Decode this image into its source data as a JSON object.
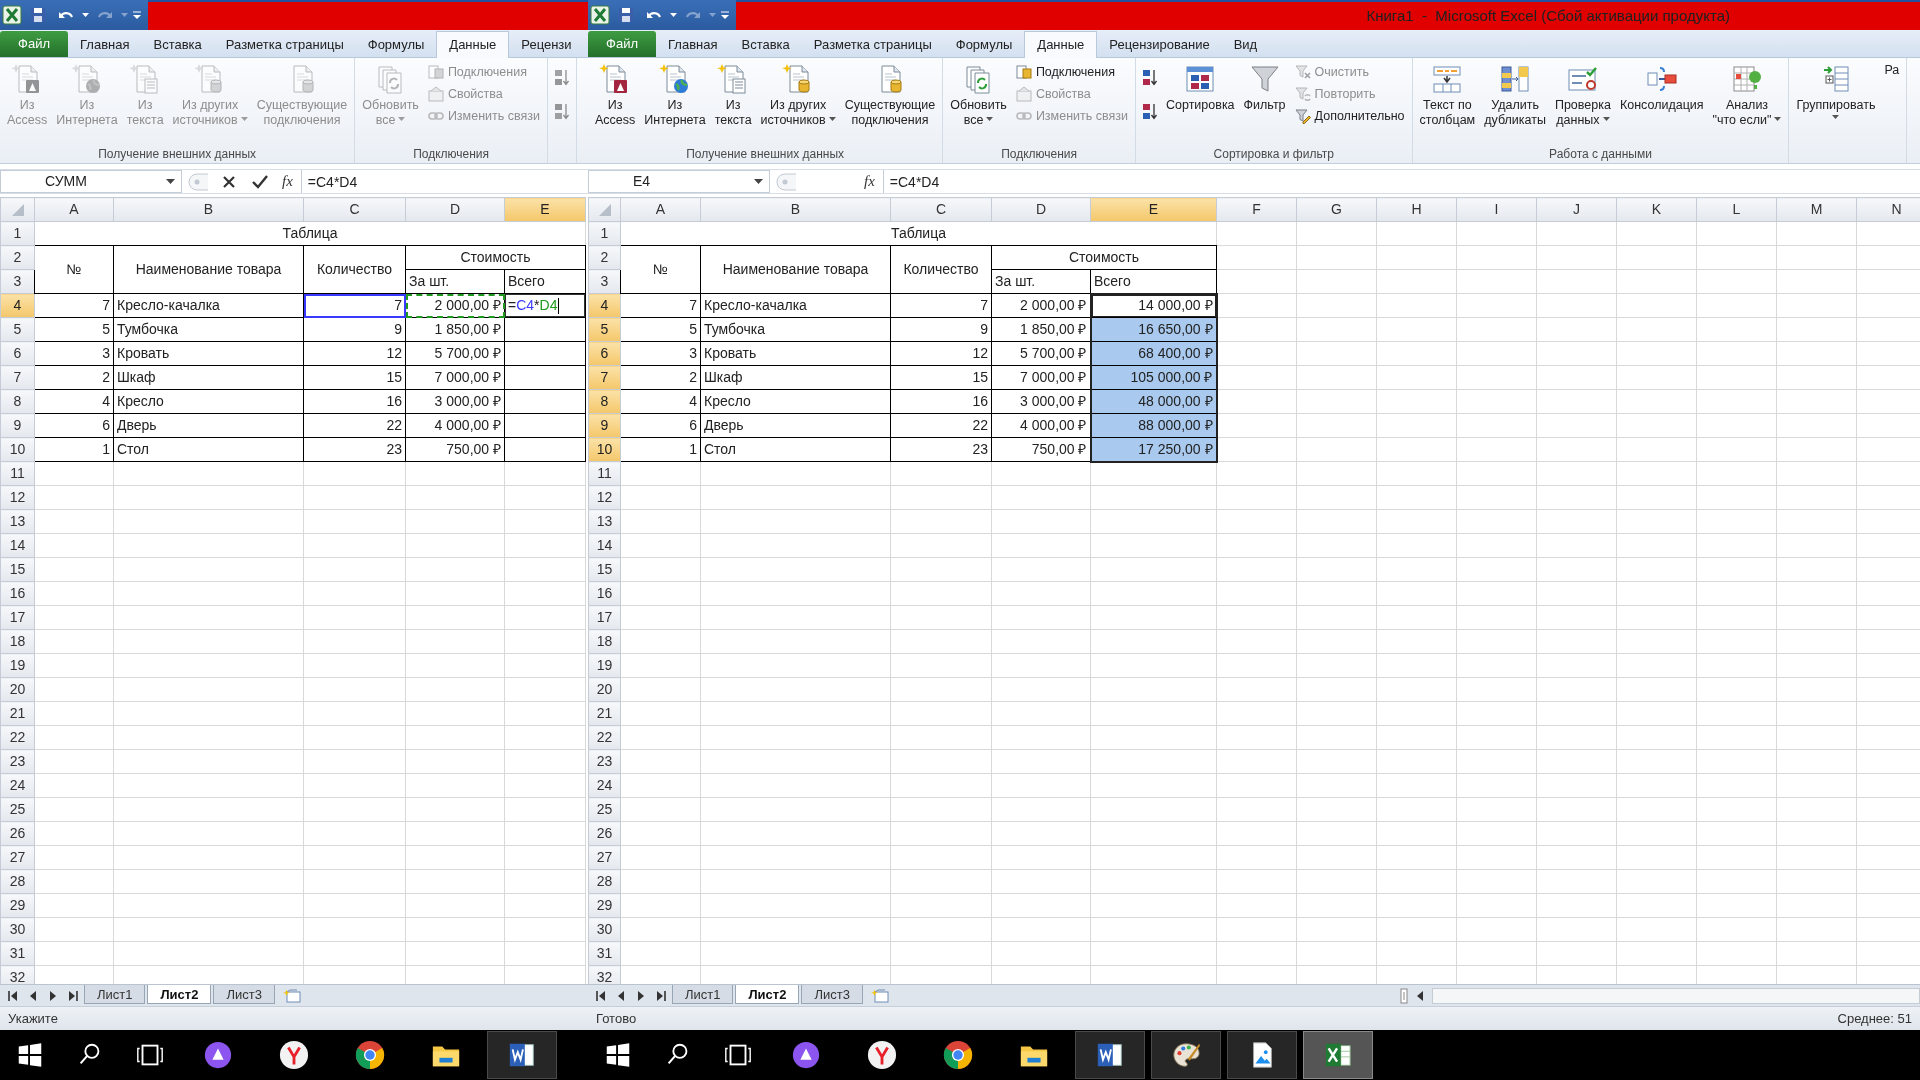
{
  "windows": [
    {
      "quick_access": [
        {
          "kind": "save",
          "disabled": false
        },
        {
          "kind": "undo",
          "disabled": false
        },
        {
          "kind": "redo",
          "disabled": true
        }
      ],
      "ribbon_tabs": [
        {
          "kind": "file",
          "label": "Файл",
          "selected": false
        },
        {
          "kind": "tab",
          "label": "Главная",
          "selected": false
        },
        {
          "kind": "tab",
          "label": "Вставка",
          "selected": false
        },
        {
          "kind": "tab",
          "label": "Разметка страницы",
          "selected": false
        },
        {
          "kind": "tab",
          "label": "Формулы",
          "selected": false
        },
        {
          "kind": "tab",
          "label": "Данные",
          "selected": true
        },
        {
          "kind": "tab",
          "label": "Рецензи",
          "selected": false
        }
      ],
      "ribbon_groups": [
        {
          "label": "Получение внешних данных",
          "items": [
            {
              "kind": "large",
              "label": "Из\nAccess",
              "disabled": true,
              "dropdown": false
            },
            {
              "kind": "large",
              "label": "Из\nИнтернета",
              "disabled": true,
              "dropdown": false
            },
            {
              "kind": "large",
              "label": "Из\nтекста",
              "disabled": true,
              "dropdown": false
            },
            {
              "kind": "large",
              "label": "Из других\nисточников",
              "disabled": true,
              "dropdown": true
            },
            {
              "kind": "large",
              "label": "Существующие\nподключения",
              "disabled": true,
              "dropdown": false
            }
          ]
        },
        {
          "label": "Подключения",
          "items": [
            {
              "kind": "large",
              "label": "Обновить\nвсе",
              "disabled": true,
              "dropdown": true
            },
            {
              "kind": "small",
              "label": "Подключения",
              "disabled": true,
              "dropdown": false
            },
            {
              "kind": "small",
              "label": "Свойства",
              "disabled": true,
              "dropdown": false
            },
            {
              "kind": "small",
              "label": "Изменить связи",
              "disabled": true,
              "dropdown": false
            }
          ]
        },
        {
          "items": [
            {
              "kind": "icon",
              "disabled": true,
              "dropdown": false
            },
            {
              "kind": "icon",
              "disabled": true,
              "dropdown": false
            }
          ]
        }
      ],
      "formula_bar": {
        "name_box": "СУММ",
        "editing": true,
        "function_label": "fx",
        "formula": "=C4*D4"
      },
      "sheet": {
        "columns": [
          {
            "label": "A",
            "selected": false
          },
          {
            "label": "B",
            "selected": false
          },
          {
            "label": "C",
            "selected": false
          },
          {
            "label": "D",
            "selected": false
          },
          {
            "label": "E",
            "selected": true
          }
        ],
        "row_headers": [
          {
            "label": "1",
            "selected": false
          },
          {
            "label": "2",
            "selected": false
          },
          {
            "label": "3",
            "selected": false
          },
          {
            "label": "4",
            "selected": true
          },
          {
            "label": "5",
            "selected": false
          },
          {
            "label": "6",
            "selected": false
          },
          {
            "label": "7",
            "selected": false
          },
          {
            "label": "8",
            "selected": false
          },
          {
            "label": "9",
            "selected": false
          },
          {
            "label": "10",
            "selected": false
          },
          {
            "label": "11",
            "selected": false
          },
          {
            "label": "12",
            "selected": false
          },
          {
            "label": "13",
            "selected": false
          },
          {
            "label": "14",
            "selected": false
          },
          {
            "label": "15",
            "selected": false
          },
          {
            "label": "16",
            "selected": false
          },
          {
            "label": "17",
            "selected": false
          },
          {
            "label": "18",
            "selected": false
          },
          {
            "label": "19",
            "selected": false
          },
          {
            "label": "20",
            "selected": false
          },
          {
            "label": "21",
            "selected": false
          },
          {
            "label": "22",
            "selected": false
          },
          {
            "label": "23",
            "selected": false
          },
          {
            "label": "24",
            "selected": false
          },
          {
            "label": "25",
            "selected": false
          },
          {
            "label": "26",
            "selected": false
          },
          {
            "label": "27",
            "selected": false
          },
          {
            "label": "28",
            "selected": false
          },
          {
            "label": "29",
            "selected": false
          },
          {
            "label": "30",
            "selected": false
          },
          {
            "label": "31",
            "selected": false
          },
          {
            "label": "32",
            "selected": false
          }
        ],
        "table": {
          "title": "Таблица",
          "headers": {
            "no": "№",
            "name": "Наименование товара",
            "qty": "Количество",
            "cost": "Стоимость",
            "unit": "За шт.",
            "total": "Всего"
          },
          "rows": [
            {
              "no": "7",
              "name": "Кресло-качалка",
              "qty": "7",
              "unit": "2 000,00 ₽",
              "total_selected": false,
              "total_active": false,
              "formula_parts": [
                {
                  "text": "="
                },
                {
                  "text": "C4",
                  "color": "#3a3aff"
                },
                {
                  "text": "*"
                },
                {
                  "text": "D4",
                  "color": "#1e9a1e"
                }
              ],
              "refs": {
                "qty": {
                  "color": "#3a3aff"
                },
                "unit": {
                  "color": "#1e9a1e"
                }
              }
            },
            {
              "no": "5",
              "name": "Тумбочка",
              "qty": "9",
              "unit": "1 850,00 ₽",
              "total_selected": false,
              "total_active": false
            },
            {
              "no": "3",
              "name": "Кровать",
              "qty": "12",
              "unit": "5 700,00 ₽",
              "total_selected": false,
              "total_active": false
            },
            {
              "no": "2",
              "name": "Шкаф",
              "qty": "15",
              "unit": "7 000,00 ₽",
              "total_selected": false,
              "total_active": false
            },
            {
              "no": "4",
              "name": "Кресло",
              "qty": "16",
              "unit": "3 000,00 ₽",
              "total_selected": false,
              "total_active": false
            },
            {
              "no": "6",
              "name": "Дверь",
              "qty": "22",
              "unit": "4 000,00 ₽",
              "total_selected": false,
              "total_active": false
            },
            {
              "no": "1",
              "name": "Стол",
              "qty": "23",
              "unit": "750,00 ₽",
              "total_selected": false,
              "total_active": false
            }
          ]
        }
      },
      "sheet_tabs": [
        {
          "label": "Лист1",
          "selected": false
        },
        {
          "label": "Лист2",
          "selected": true
        },
        {
          "label": "Лист3",
          "selected": false
        }
      ],
      "status": {
        "mode": "Укажите"
      },
      "taskbar": [
        {
          "kind": "start",
          "running": false,
          "active": false
        },
        {
          "kind": "search",
          "running": false,
          "active": false
        },
        {
          "kind": "taskview",
          "running": false,
          "active": false
        },
        {
          "kind": "assistant",
          "running": false,
          "active": false
        },
        {
          "kind": "ybrowser",
          "running": false,
          "active": false
        },
        {
          "kind": "chrome",
          "running": false,
          "active": false
        },
        {
          "kind": "explorer",
          "running": false,
          "active": false
        },
        {
          "kind": "word",
          "running": true,
          "active": false
        }
      ]
    },
    {
      "title": "Книга1  -  Microsoft Excel (Сбой активации продукта)",
      "quick_access": [
        {
          "kind": "save",
          "disabled": false
        },
        {
          "kind": "undo",
          "disabled": false
        },
        {
          "kind": "redo",
          "disabled": true
        }
      ],
      "ribbon_tabs": [
        {
          "kind": "file",
          "label": "Файл",
          "selected": false
        },
        {
          "kind": "tab",
          "label": "Главная",
          "selected": false
        },
        {
          "kind": "tab",
          "label": "Вставка",
          "selected": false
        },
        {
          "kind": "tab",
          "label": "Разметка страницы",
          "selected": false
        },
        {
          "kind": "tab",
          "label": "Формулы",
          "selected": false
        },
        {
          "kind": "tab",
          "label": "Данные",
          "selected": true
        },
        {
          "kind": "tab",
          "label": "Рецензирование",
          "selected": false
        },
        {
          "kind": "tab",
          "label": "Вид",
          "selected": false
        }
      ],
      "ribbon_groups": [
        {
          "label": "Получение внешних данных",
          "items": [
            {
              "kind": "large",
              "label": "Из\nAccess",
              "disabled": false,
              "dropdown": false
            },
            {
              "kind": "large",
              "label": "Из\nИнтернета",
              "disabled": false,
              "dropdown": false
            },
            {
              "kind": "large",
              "label": "Из\nтекста",
              "disabled": false,
              "dropdown": false
            },
            {
              "kind": "large",
              "label": "Из других\nисточников",
              "disabled": false,
              "dropdown": true
            },
            {
              "kind": "large",
              "label": "Существующие\nподключения",
              "disabled": false,
              "dropdown": false
            }
          ]
        },
        {
          "label": "Подключения",
          "items": [
            {
              "kind": "large",
              "label": "Обновить\nвсе",
              "disabled": false,
              "dropdown": true
            },
            {
              "kind": "small",
              "label": "Подключения",
              "disabled": false,
              "dropdown": false
            },
            {
              "kind": "small",
              "label": "Свойства",
              "disabled": true,
              "dropdown": false
            },
            {
              "kind": "small",
              "label": "Изменить связи",
              "disabled": true,
              "dropdown": false
            }
          ]
        },
        {
          "label": "Сортировка и фильтр",
          "items": [
            {
              "kind": "icon",
              "disabled": false,
              "dropdown": false
            },
            {
              "kind": "icon",
              "disabled": false,
              "dropdown": false
            },
            {
              "kind": "large",
              "label": "Сортировка",
              "disabled": false,
              "dropdown": false
            },
            {
              "kind": "large",
              "label": "Фильтр",
              "disabled": false,
              "dropdown": false
            },
            {
              "kind": "small",
              "label": "Очистить",
              "disabled": true,
              "dropdown": false
            },
            {
              "kind": "small",
              "label": "Повторить",
              "disabled": true,
              "dropdown": false
            },
            {
              "kind": "small",
              "label": "Дополнительно",
              "disabled": false,
              "dropdown": false
            }
          ]
        },
        {
          "label": "Работа с данными",
          "items": [
            {
              "kind": "large",
              "label": "Текст по\nстолбцам",
              "disabled": false,
              "dropdown": false
            },
            {
              "kind": "large",
              "label": "Удалить\nдубликаты",
              "disabled": false,
              "dropdown": false
            },
            {
              "kind": "large",
              "label": "Проверка\nданных",
              "disabled": false,
              "dropdown": true
            },
            {
              "kind": "large",
              "label": "Консолидация",
              "disabled": false,
              "dropdown": false
            },
            {
              "kind": "large",
              "label": "Анализ\n\"что если\"",
              "disabled": false,
              "dropdown": true
            }
          ]
        },
        {
          "items": [
            {
              "kind": "large",
              "label": "Группировать",
              "disabled": false,
              "dropdown": true
            },
            {
              "kind": "large",
              "label": "Ра",
              "disabled": false,
              "dropdown": false
            }
          ]
        }
      ],
      "formula_bar": {
        "name_box": "E4",
        "editing": false,
        "function_label": "fx",
        "formula": "=C4*D4"
      },
      "sheet": {
        "columns": [
          {
            "label": "A",
            "selected": false
          },
          {
            "label": "B",
            "selected": false
          },
          {
            "label": "C",
            "selected": false
          },
          {
            "label": "D",
            "selected": false
          },
          {
            "label": "E",
            "selected": true
          },
          {
            "label": "F",
            "selected": false
          },
          {
            "label": "G",
            "selected": false
          },
          {
            "label": "H",
            "selected": false
          },
          {
            "label": "I",
            "selected": false
          },
          {
            "label": "J",
            "selected": false
          },
          {
            "label": "K",
            "selected": false
          },
          {
            "label": "L",
            "selected": false
          },
          {
            "label": "M",
            "selected": false
          },
          {
            "label": "N",
            "selected": false
          }
        ],
        "row_headers": [
          {
            "label": "1",
            "selected": false
          },
          {
            "label": "2",
            "selected": false
          },
          {
            "label": "3",
            "selected": false
          },
          {
            "label": "4",
            "selected": true
          },
          {
            "label": "5",
            "selected": true
          },
          {
            "label": "6",
            "selected": true
          },
          {
            "label": "7",
            "selected": true
          },
          {
            "label": "8",
            "selected": true
          },
          {
            "label": "9",
            "selected": true
          },
          {
            "label": "10",
            "selected": true
          },
          {
            "label": "11",
            "selected": false
          },
          {
            "label": "12",
            "selected": false
          },
          {
            "label": "13",
            "selected": false
          },
          {
            "label": "14",
            "selected": false
          },
          {
            "label": "15",
            "selected": false
          },
          {
            "label": "16",
            "selected": false
          },
          {
            "label": "17",
            "selected": false
          },
          {
            "label": "18",
            "selected": false
          },
          {
            "label": "19",
            "selected": false
          },
          {
            "label": "20",
            "selected": false
          },
          {
            "label": "21",
            "selected": false
          },
          {
            "label": "22",
            "selected": false
          },
          {
            "label": "23",
            "selected": false
          },
          {
            "label": "24",
            "selected": false
          },
          {
            "label": "25",
            "selected": false
          },
          {
            "label": "26",
            "selected": false
          },
          {
            "label": "27",
            "selected": false
          },
          {
            "label": "28",
            "selected": false
          },
          {
            "label": "29",
            "selected": false
          },
          {
            "label": "30",
            "selected": false
          },
          {
            "label": "31",
            "selected": false
          },
          {
            "label": "32",
            "selected": false
          }
        ],
        "table": {
          "title": "Таблица",
          "headers": {
            "no": "№",
            "name": "Наименование товара",
            "qty": "Количество",
            "cost": "Стоимость",
            "unit": "За шт.",
            "total": "Всего"
          },
          "rows": [
            {
              "no": "7",
              "name": "Кресло-качалка",
              "qty": "7",
              "unit": "2 000,00 ₽",
              "total": "14 000,00 ₽",
              "total_selected": true,
              "total_active": true
            },
            {
              "no": "5",
              "name": "Тумбочка",
              "qty": "9",
              "unit": "1 850,00 ₽",
              "total": "16 650,00 ₽",
              "total_selected": true,
              "total_active": false
            },
            {
              "no": "3",
              "name": "Кровать",
              "qty": "12",
              "unit": "5 700,00 ₽",
              "total": "68 400,00 ₽",
              "total_selected": true,
              "total_active": false
            },
            {
              "no": "2",
              "name": "Шкаф",
              "qty": "15",
              "unit": "7 000,00 ₽",
              "total": "105 000,00 ₽",
              "total_selected": true,
              "total_active": false
            },
            {
              "no": "4",
              "name": "Кресло",
              "qty": "16",
              "unit": "3 000,00 ₽",
              "total": "48 000,00 ₽",
              "total_selected": true,
              "total_active": false
            },
            {
              "no": "6",
              "name": "Дверь",
              "qty": "22",
              "unit": "4 000,00 ₽",
              "total": "88 000,00 ₽",
              "total_selected": true,
              "total_active": false
            },
            {
              "no": "1",
              "name": "Стол",
              "qty": "23",
              "unit": "750,00 ₽",
              "total": "17 250,00 ₽",
              "total_selected": true,
              "total_active": false
            }
          ]
        }
      },
      "sheet_tabs": [
        {
          "label": "Лист1",
          "selected": false
        },
        {
          "label": "Лист2",
          "selected": true
        },
        {
          "label": "Лист3",
          "selected": false
        }
      ],
      "status": {
        "mode": "Готово",
        "summary": "Среднее: 51"
      },
      "taskbar": [
        {
          "kind": "start",
          "running": false,
          "active": false
        },
        {
          "kind": "search",
          "running": false,
          "active": false
        },
        {
          "kind": "taskview",
          "running": false,
          "active": false
        },
        {
          "kind": "assistant",
          "running": false,
          "active": false
        },
        {
          "kind": "ybrowser",
          "running": false,
          "active": false
        },
        {
          "kind": "chrome",
          "running": false,
          "active": false
        },
        {
          "kind": "explorer",
          "running": false,
          "active": false
        },
        {
          "kind": "word",
          "running": true,
          "active": false
        },
        {
          "kind": "paint",
          "running": true,
          "active": false
        },
        {
          "kind": "photos",
          "running": true,
          "active": false
        },
        {
          "kind": "excel",
          "running": true,
          "active": true
        }
      ]
    }
  ]
}
